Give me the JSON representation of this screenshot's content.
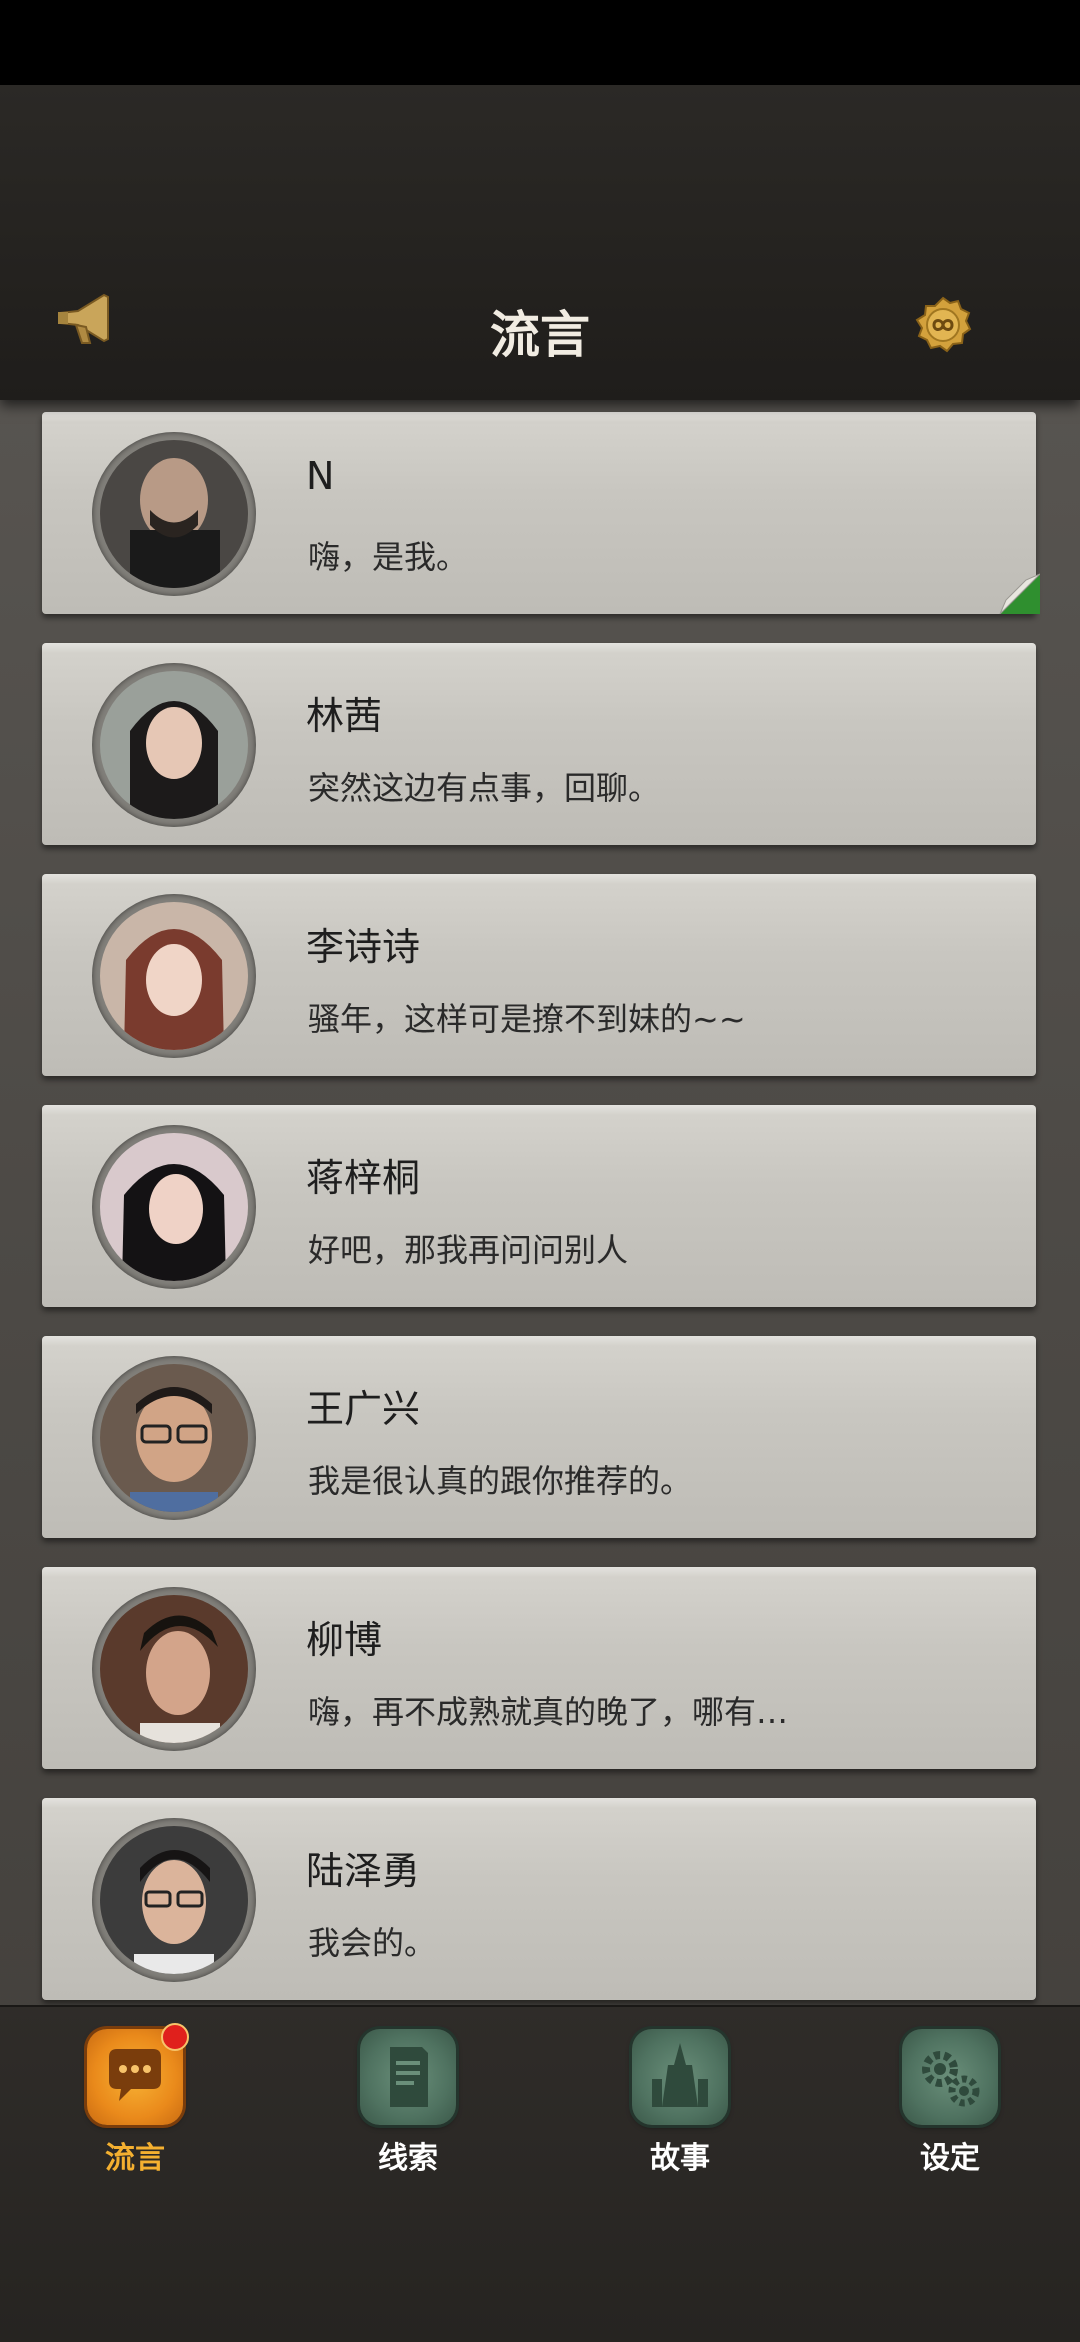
{
  "header": {
    "title": "流言",
    "left_icon": "megaphone-icon",
    "right_icon": "gold-coin-icon"
  },
  "conversations": [
    {
      "name": "N",
      "message": "嗨，是我。",
      "unread_marker": true
    },
    {
      "name": "林茜",
      "message": "突然这边有点事，回聊。"
    },
    {
      "name": "李诗诗",
      "message": "骚年，这样可是撩不到妹的~~"
    },
    {
      "name": "蒋梓桐",
      "message": "好吧，那我再问问别人"
    },
    {
      "name": "王广兴",
      "message": "我是很认真的跟你推荐的。"
    },
    {
      "name": "柳博",
      "message": "嗨，再不成熟就真的晚了，哪有…"
    },
    {
      "name": "陆泽勇",
      "message": "我会的。"
    }
  ],
  "tabs": [
    {
      "label": "流言",
      "icon": "chat-bubble-icon",
      "active": true,
      "badge": true
    },
    {
      "label": "线索",
      "icon": "document-icon",
      "active": false
    },
    {
      "label": "故事",
      "icon": "castle-icon",
      "active": false
    },
    {
      "label": "设定",
      "icon": "gears-icon",
      "active": false
    }
  ],
  "colors": {
    "accent": "#f4b030",
    "badge": "#e0201c",
    "inactive_tab": "#4f7260"
  }
}
